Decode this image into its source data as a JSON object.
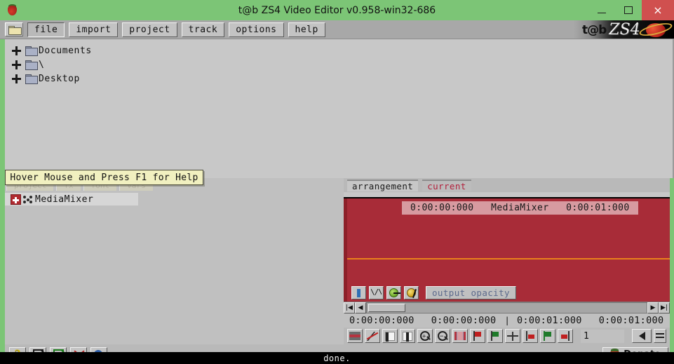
{
  "window": {
    "title": "t@b ZS4 Video Editor v0.958-win32-686",
    "app_icon": "strawberry-icon",
    "minimize_label": "",
    "maximize_label": "",
    "close_label": "×",
    "accent_green": "#7cc576",
    "close_red": "#d0504f",
    "chrome_gray": "#b9b9b9",
    "track_red": "#a82c38",
    "automation_orange": "#e8821c"
  },
  "menubar": {
    "folder_button": "open-folder",
    "items": [
      {
        "label": "file",
        "active": true
      },
      {
        "label": "import",
        "active": false
      },
      {
        "label": "project",
        "active": false
      },
      {
        "label": "track",
        "active": false
      },
      {
        "label": "options",
        "active": false
      },
      {
        "label": "help",
        "active": false
      }
    ],
    "logo_text_1": "t@b",
    "logo_text_2": "ZS4"
  },
  "file_tree": {
    "items": [
      {
        "label": "Documents",
        "expander": "+"
      },
      {
        "label": "\\",
        "expander": "+"
      },
      {
        "label": "Desktop",
        "expander": "+"
      }
    ]
  },
  "tooltip": {
    "text": "Hover Mouse and Press F1 for Help"
  },
  "left_panel": {
    "tabs": [
      {
        "label": "project"
      },
      {
        "label": "fx"
      },
      {
        "label": "font"
      },
      {
        "label": "vars"
      }
    ],
    "items": [
      {
        "label": "MediaMixer",
        "expander": "+"
      }
    ]
  },
  "arrangement": {
    "tabs": [
      {
        "label": "arrangement",
        "selected": true
      },
      {
        "label": "current",
        "selected": false
      }
    ],
    "clip": {
      "start": "0:00:00:000",
      "name": "MediaMixer",
      "end": "0:00:01:000",
      "full_label": "0:00:00:000   MediaMixer   0:00:01:000"
    },
    "track_tools": [
      {
        "icon": "info-icon"
      },
      {
        "icon": "waveform-icon"
      },
      {
        "icon": "green-keyframe-icon"
      },
      {
        "icon": "yellow-keyframe-icon"
      }
    ],
    "parameter_label": "output opacity"
  },
  "scrollbar": {
    "first_button": "skip-to-start-icon",
    "prev_button": "step-back-icon",
    "next_button": "step-forward-icon",
    "last_button": "skip-to-end-icon"
  },
  "timecodes": {
    "t1": "0:00:00:000",
    "t2": "0:00:00:000",
    "separator": "|",
    "t3": "0:00:01:000",
    "t4": "0:00:01:000"
  },
  "timeline_tools": {
    "buttons": [
      {
        "icon": "color-bars-icon"
      },
      {
        "icon": "razor-cut-icon"
      },
      {
        "icon": "split-left-icon"
      },
      {
        "icon": "split-right-icon"
      },
      {
        "icon": "zoom-in-icon",
        "sign": "+"
      },
      {
        "icon": "zoom-out-icon",
        "sign": "−"
      },
      {
        "icon": "select-range-icon"
      },
      {
        "icon": "red-flag-icon"
      },
      {
        "icon": "green-flag-icon"
      },
      {
        "icon": "center-playhead-icon"
      },
      {
        "icon": "mark-in-icon"
      },
      {
        "icon": "marker-green-icon"
      },
      {
        "icon": "mark-out-icon"
      }
    ],
    "value": "1",
    "end_buttons": [
      {
        "icon": "arrow-left-icon"
      },
      {
        "icon": "list-menu-icon"
      }
    ]
  },
  "bottom_toolbar": {
    "buttons": [
      {
        "icon": "help-question-icon"
      },
      {
        "icon": "load-project-icon"
      },
      {
        "icon": "save-project-icon"
      },
      {
        "icon": "clear-tools-icon"
      },
      {
        "icon": "render-go-icon"
      }
    ],
    "donate_label": "Donate",
    "donate_icon": "strawberry-icon"
  },
  "statusbar": {
    "message": "done."
  }
}
